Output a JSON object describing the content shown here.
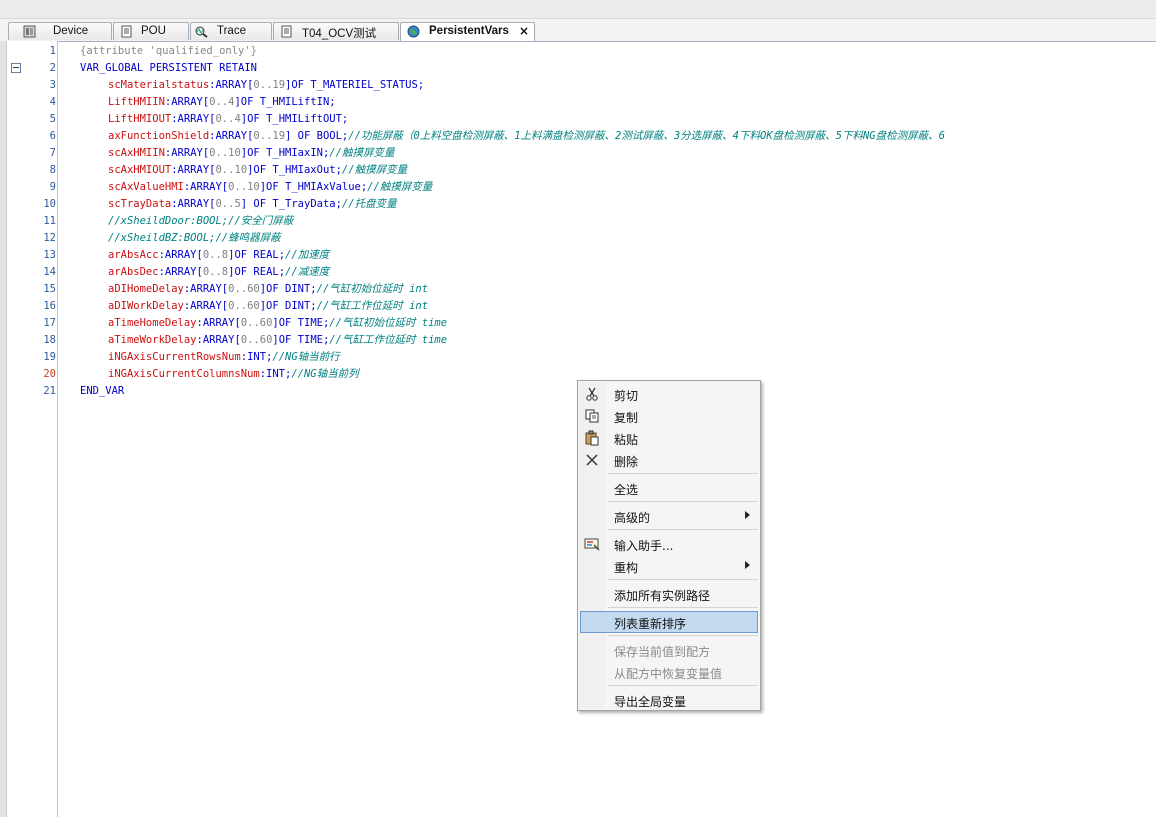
{
  "tabs": [
    {
      "label": "Device",
      "icon": "device-icon"
    },
    {
      "label": "POU",
      "icon": "pou-icon"
    },
    {
      "label": "Trace",
      "icon": "trace-icon"
    },
    {
      "label": "T04_OCV测试",
      "icon": "document-icon"
    },
    {
      "label": "PersistentVars",
      "icon": "globe-icon",
      "active": true,
      "close": "×"
    }
  ],
  "gutter": {
    "line_numbers": [
      "1",
      "2",
      "3",
      "4",
      "5",
      "6",
      "7",
      "8",
      "9",
      "10",
      "11",
      "12",
      "13",
      "14",
      "15",
      "16",
      "17",
      "18",
      "19",
      "20",
      "21"
    ]
  },
  "code": {
    "attr": "{attribute 'qualified_only'}",
    "header": "VAR_GLOBAL PERSISTENT RETAIN",
    "footer": "END_VAR",
    "declarations": [
      {
        "name": "scMaterialstatus",
        "pre": ":ARRAY[",
        "range": "0..19",
        "post": "]OF T_MATERIEL_STATUS;",
        "comment": ""
      },
      {
        "name": "LiftHMIIN",
        "pre": ":ARRAY[",
        "range": "0..4",
        "post": "]OF T_HMILiftIN;",
        "comment": ""
      },
      {
        "name": "LiftHMIOUT",
        "pre": ":ARRAY[",
        "range": "0..4",
        "post": "]OF T_HMILiftOUT;",
        "comment": ""
      },
      {
        "name": "axFunctionShield",
        "pre": ":ARRAY[",
        "range": "0..19",
        "post": "] OF BOOL;",
        "comment": "//功能屏蔽（0上料空盘检测屏蔽、1上料满盘检测屏蔽、2测试屏蔽、3分选屏蔽、4下料OK盘检测屏蔽、5下料NG盘检测屏蔽、6"
      },
      {
        "name": "scAxHMIIN",
        "pre": ":ARRAY[",
        "range": "0..10",
        "post": "]OF T_HMIaxIN;",
        "comment": "//触摸屏变量"
      },
      {
        "name": "scAxHMIOUT",
        "pre": ":ARRAY[",
        "range": "0..10",
        "post": "]OF T_HMIaxOut;",
        "comment": "//触摸屏变量"
      },
      {
        "name": "scAxValueHMI",
        "pre": ":ARRAY[",
        "range": "0..10",
        "post": "]OF T_HMIAxValue;",
        "comment": "//触摸屏变量"
      },
      {
        "name": "scTrayData",
        "pre": ":ARRAY[",
        "range": "0..5",
        "post": "] OF T_TrayData;",
        "comment": "//托盘变量"
      },
      {
        "name": "",
        "pre": "",
        "range": "",
        "post": "",
        "comment": "//xSheildDoor:BOOL;//安全门屏蔽"
      },
      {
        "name": "",
        "pre": "",
        "range": "",
        "post": "",
        "comment": "//xSheildBZ:BOOL;//蜂鸣器屏蔽"
      },
      {
        "name": "arAbsAcc",
        "pre": ":ARRAY[",
        "range": "0..8",
        "post": "]OF REAL;",
        "comment": "//加速度"
      },
      {
        "name": "arAbsDec",
        "pre": ":ARRAY[",
        "range": "0..8",
        "post": "]OF REAL;",
        "comment": "//减速度"
      },
      {
        "name": "aDIHomeDelay",
        "pre": ":ARRAY[",
        "range": "0..60",
        "post": "]OF DINT;",
        "comment": "//气缸初始位延时 int"
      },
      {
        "name": "aDIWorkDelay",
        "pre": ":ARRAY[",
        "range": "0..60",
        "post": "]OF DINT;",
        "comment": "//气缸工作位延时 int"
      },
      {
        "name": "aTimeHomeDelay",
        "pre": ":ARRAY[",
        "range": "0..60",
        "post": "]OF TIME;",
        "comment": "//气缸初始位延时 time"
      },
      {
        "name": "aTimeWorkDelay",
        "pre": ":ARRAY[",
        "range": "0..60",
        "post": "]OF TIME;",
        "comment": "//气缸工作位延时 time"
      },
      {
        "name": "iNGAxisCurrentRowsNum",
        "pre": ":INT;",
        "range": "",
        "post": "",
        "comment": "//NG轴当前行"
      },
      {
        "name": "iNGAxisCurrentColumnsNum",
        "pre": ":INT;",
        "range": "",
        "post": "",
        "comment": "//NG轴当前列"
      }
    ]
  },
  "context_menu": {
    "cut": "剪切",
    "copy": "复制",
    "paste": "粘贴",
    "delete": "删除",
    "select_all": "全选",
    "advanced": "高级的",
    "input_assistant": "输入助手...",
    "refactor": "重构",
    "add_all_instance_paths": "添加所有实例路径",
    "reorder_list": "列表重新排序",
    "save_to_recipe": "保存当前值到配方",
    "restore_from_recipe": "从配方中恢复变量值",
    "export_globals": "导出全局变量"
  },
  "colors": {
    "keyword": "#0000cd",
    "variable": "#cc1010",
    "comment": "#008080",
    "highlight": "#c3d9ef"
  }
}
